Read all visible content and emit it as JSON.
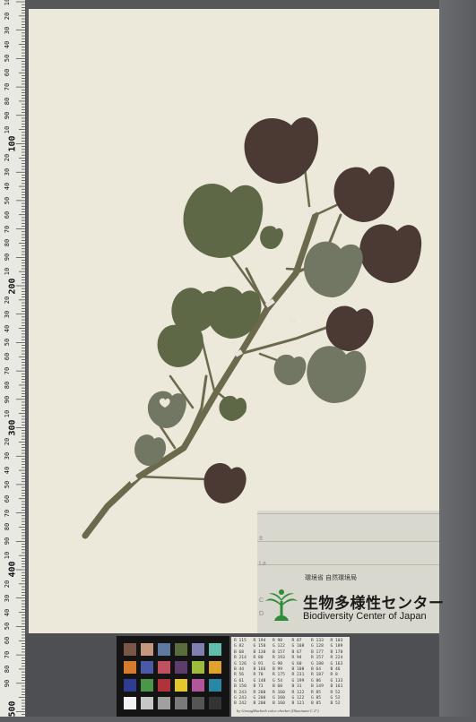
{
  "ruler": {
    "labels": [
      "100",
      "200",
      "300",
      "400",
      "500"
    ],
    "minor_labels": [
      "10",
      "20",
      "30",
      "40",
      "50",
      "60",
      "70",
      "80",
      "90"
    ]
  },
  "specimen": {
    "leaf_color": "#5f6846",
    "dark_leaf_color": "#4a3a33",
    "stem_color": "#6b6a4d"
  },
  "label": {
    "org_small_jp": "環境省 自然環境局",
    "org_jp": "生物多様性センター",
    "org_en": "Biodiversity Center of Japan",
    "faded_left": [
      "It",
      "La",
      "C",
      "D"
    ]
  },
  "color_checker": {
    "swatches": [
      [
        "#7a5646",
        "#c59680",
        "#5e7aa0",
        "#596c3b",
        "#7f80b0",
        "#5fbdaa"
      ],
      [
        "#d47c2c",
        "#4a5aa8",
        "#c0525f",
        "#5b3c6a",
        "#9dbb3c",
        "#e0a22d"
      ],
      [
        "#2f3c8f",
        "#4c9649",
        "#b0333b",
        "#e6c72b",
        "#b3559a",
        "#2a86a6"
      ],
      [
        "#f2f2f0",
        "#c6c6c4",
        "#a0a09f",
        "#7a7a79",
        "#555555",
        "#343434"
      ]
    ]
  },
  "card": {
    "columns": [
      [
        "R 115",
        "G 82",
        "B 68",
        "R 214",
        "G 126",
        "B 44",
        "R 56",
        "G 61",
        "B 150",
        "R 243",
        "G 243",
        "B 242"
      ],
      [
        "R 194",
        "G 150",
        "B 130",
        "R 80",
        "G 91",
        "B 166",
        "R 70",
        "G 148",
        "B 73",
        "R 200",
        "G 200",
        "B 200"
      ],
      [
        "R 98",
        "G 122",
        "B 157",
        "R 193",
        "G 90",
        "B 99",
        "R 175",
        "G 54",
        "B 60",
        "R 160",
        "G 160",
        "B 160"
      ],
      [
        "R 87",
        "G 108",
        "B 67",
        "R 94",
        "G 60",
        "B 108",
        "R 231",
        "G 199",
        "B 31",
        "R 122",
        "G 122",
        "B 121"
      ],
      [
        "R 133",
        "G 128",
        "B 177",
        "R 157",
        "G 188",
        "B 64",
        "R 187",
        "G 86",
        "B 149",
        "R 85",
        "G 85",
        "B 85"
      ],
      [
        "R 103",
        "G 189",
        "B 170",
        "R 224",
        "G 163",
        "B 46",
        "R 8",
        "G 133",
        "B 161",
        "R 52",
        "G 52",
        "B 52"
      ]
    ],
    "footer": "by GretagMacbeth color checker (Illuminant C 2°)"
  }
}
